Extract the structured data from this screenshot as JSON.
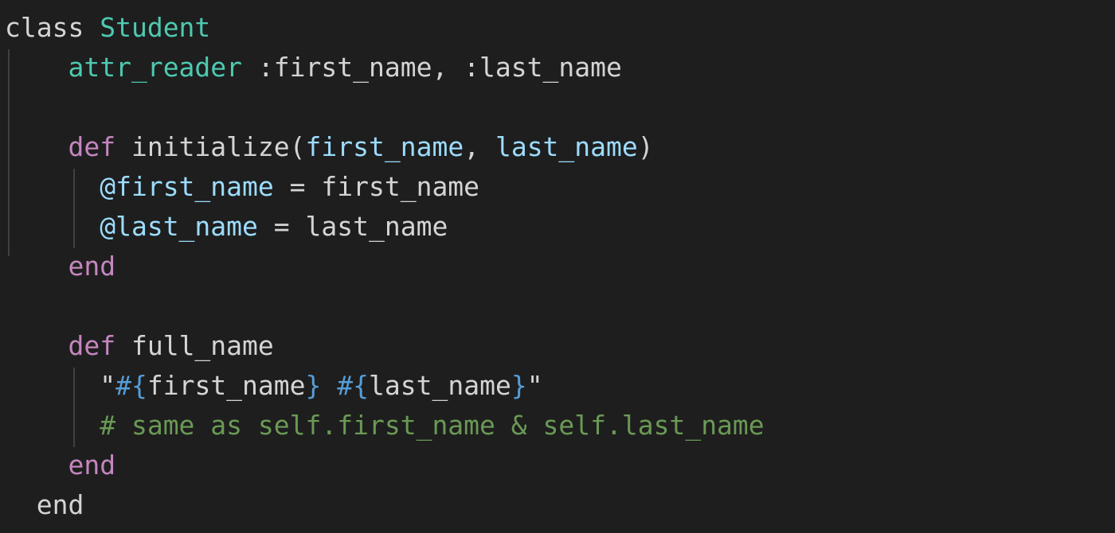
{
  "editor": {
    "colors": {
      "background": "#1e1e1e",
      "keyword": "#c586c0",
      "storage": "#c586c0",
      "class_name": "#4ec9b0",
      "method_call": "#4fc1ff",
      "parameter": "#9cdcfe",
      "instance_var": "#9cdcfe",
      "string": "#ce9178",
      "interpolation_punct": "#569cd6",
      "comment": "#6a9955",
      "plain": "#d4d4d4",
      "indent_guide": "#404040"
    },
    "lines": [
      {
        "tokens": [
          {
            "text": "class",
            "color": "#d4d4d4"
          },
          {
            "text": " ",
            "color": "#d4d4d4"
          },
          {
            "text": "Student",
            "color": "#4ec9b0"
          }
        ]
      },
      {
        "tokens": [
          {
            "text": "    ",
            "color": "#d4d4d4"
          },
          {
            "text": "attr_reader",
            "color": "#4ec9b0"
          },
          {
            "text": " :first_name, :last_name",
            "color": "#d4d4d4"
          }
        ]
      },
      {
        "tokens": [
          {
            "text": "",
            "color": "#d4d4d4"
          }
        ]
      },
      {
        "tokens": [
          {
            "text": "    ",
            "color": "#d4d4d4"
          },
          {
            "text": "def",
            "color": "#c586c0"
          },
          {
            "text": " initialize(",
            "color": "#d4d4d4"
          },
          {
            "text": "first_name",
            "color": "#9cdcfe"
          },
          {
            "text": ", ",
            "color": "#d4d4d4"
          },
          {
            "text": "last_name",
            "color": "#9cdcfe"
          },
          {
            "text": ")",
            "color": "#d4d4d4"
          }
        ]
      },
      {
        "tokens": [
          {
            "text": "      ",
            "color": "#d4d4d4"
          },
          {
            "text": "@first_name",
            "color": "#9cdcfe"
          },
          {
            "text": " = first_name",
            "color": "#d4d4d4"
          }
        ]
      },
      {
        "tokens": [
          {
            "text": "      ",
            "color": "#d4d4d4"
          },
          {
            "text": "@last_name",
            "color": "#9cdcfe"
          },
          {
            "text": " = last_name",
            "color": "#d4d4d4"
          }
        ]
      },
      {
        "tokens": [
          {
            "text": "    ",
            "color": "#d4d4d4"
          },
          {
            "text": "end",
            "color": "#c586c0"
          }
        ]
      },
      {
        "tokens": [
          {
            "text": "",
            "color": "#d4d4d4"
          }
        ]
      },
      {
        "tokens": [
          {
            "text": "    ",
            "color": "#d4d4d4"
          },
          {
            "text": "def",
            "color": "#c586c0"
          },
          {
            "text": " full_name",
            "color": "#d4d4d4"
          }
        ]
      },
      {
        "tokens": [
          {
            "text": "      ",
            "color": "#d4d4d4"
          },
          {
            "text": "\"",
            "color": "#d4d4d4"
          },
          {
            "text": "#{",
            "color": "#569cd6"
          },
          {
            "text": "first_name",
            "color": "#d4d4d4"
          },
          {
            "text": "}",
            "color": "#569cd6"
          },
          {
            "text": " ",
            "color": "#d4d4d4"
          },
          {
            "text": "#{",
            "color": "#569cd6"
          },
          {
            "text": "last_name",
            "color": "#d4d4d4"
          },
          {
            "text": "}",
            "color": "#569cd6"
          },
          {
            "text": "\"",
            "color": "#d4d4d4"
          }
        ]
      },
      {
        "tokens": [
          {
            "text": "      ",
            "color": "#d4d4d4"
          },
          {
            "text": "# same as self.first_name & self.last_name",
            "color": "#6a9955"
          }
        ]
      },
      {
        "tokens": [
          {
            "text": "    ",
            "color": "#d4d4d4"
          },
          {
            "text": "end",
            "color": "#c586c0"
          }
        ]
      },
      {
        "tokens": [
          {
            "text": "  ",
            "color": "#d4d4d4"
          },
          {
            "text": "end",
            "color": "#d4d4d4"
          }
        ]
      }
    ]
  }
}
